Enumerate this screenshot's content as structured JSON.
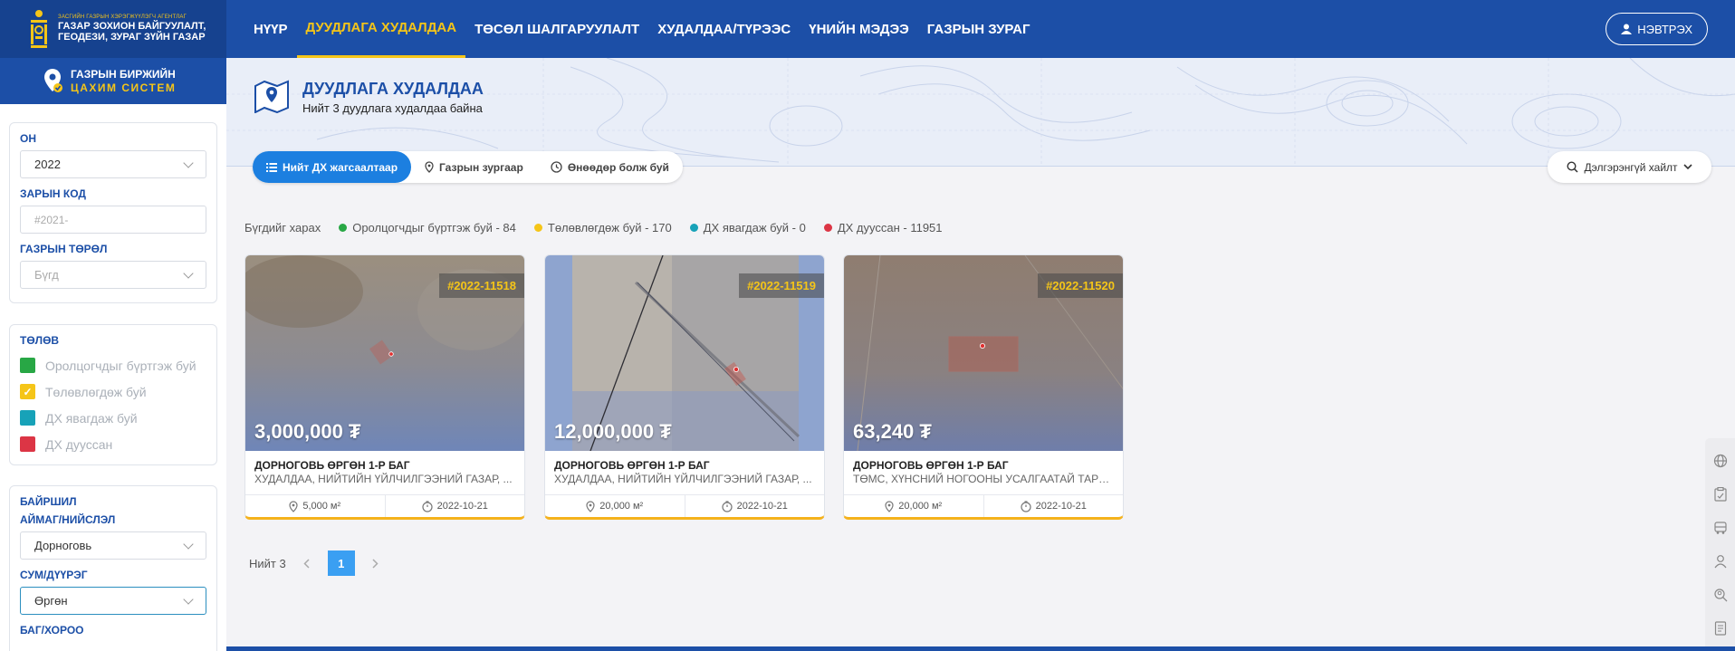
{
  "header": {
    "agency_small": "ЗАСГИЙН ГАЗРЫН ХЭРЭГЖҮҮЛЭГЧ АГЕНТЛАГ",
    "agency_line1": "ГАЗАР ЗОХИОН БАЙГУУЛАЛТ,",
    "agency_line2": "ГЕОДЕЗИ, ЗУРАГ ЗҮЙН ГАЗАР",
    "nav": [
      {
        "label": "НҮҮР"
      },
      {
        "label": "ДУУДЛАГА ХУДАЛДАА",
        "active": true
      },
      {
        "label": "ТӨСӨЛ ШАЛГАРУУЛАЛТ"
      },
      {
        "label": "ХУДАЛДАА/ТҮРЭЭС"
      },
      {
        "label": "ҮНИЙН МЭДЭЭ"
      },
      {
        "label": "ГАЗРЫН ЗУРАГ"
      }
    ],
    "login_label": "НЭВТРЭХ",
    "accent_color": "#f5c518",
    "brand_color": "#1c4fa7"
  },
  "sub_brand": {
    "line1": "ГАЗРЫН БИРЖИЙН",
    "line2": "ЦАХИМ СИСТЕМ"
  },
  "filters": {
    "year_label": "ОН",
    "year_value": "2022",
    "code_label": "ЗАРЫН КОД",
    "code_placeholder": "#2021-",
    "type_label": "ГАЗРЫН ТӨРӨЛ",
    "type_value": "Бүгд",
    "status_label": "ТӨЛӨВ",
    "statuses": [
      {
        "label": "Оролцогчдыг бүртгэж буй",
        "color": "#28a745",
        "checked": false
      },
      {
        "label": "Төлөвлөгдөж буй",
        "color": "#f5c518",
        "checked": true
      },
      {
        "label": "ДХ явагдаж буй",
        "color": "#17a2b8",
        "checked": false
      },
      {
        "label": "ДХ дууссан",
        "color": "#dc3545",
        "checked": false
      }
    ],
    "location_label": "БАЙРШИЛ",
    "aimag_label": "АЙМАГ/НИЙСЛЭЛ",
    "aimag_value": "Дорноговь",
    "sum_label": "СУМ/ДҮҮРЭГ",
    "sum_value": "Өргөн",
    "bag_label": "БАГ/ХОРОО"
  },
  "banner": {
    "title": "ДУУДЛАГА ХУДАЛДАА",
    "subtitle": "Нийт 3 дуудлага худалдаа байна"
  },
  "tabs": [
    {
      "label": "Нийт ДХ жагсаалтаар",
      "icon": "list-icon",
      "active": true
    },
    {
      "label": "Газрын зургаар",
      "icon": "map-pin-icon"
    },
    {
      "label": "Өнөөдөр болж буй",
      "icon": "clock-icon"
    }
  ],
  "advanced_search_label": "Дэлгэрэнгүй хайлт",
  "legend": {
    "all_label": "Бүгдийг харах",
    "items": [
      {
        "label": "Оролцогчдыг бүртгэж буй - 84",
        "color": "#28a745"
      },
      {
        "label": "Төлөвлөгдөж буй - 170",
        "color": "#f5c518"
      },
      {
        "label": "ДХ явагдаж буй - 0",
        "color": "#17a2b8"
      },
      {
        "label": "ДХ дууссан - 11951",
        "color": "#dc3545"
      }
    ]
  },
  "cards": [
    {
      "id": "#2022-11518",
      "price": "3,000,000 ₮",
      "location": "ДОРНОГОВЬ ӨРГӨН 1-Р БАГ",
      "description": "ХУДАЛДАА, НИЙТИЙН ҮЙЛЧИЛГЭЭНИЙ ГАЗАР, ...",
      "area": "5,000 м²",
      "date": "2022-10-21"
    },
    {
      "id": "#2022-11519",
      "price": "12,000,000 ₮",
      "location": "ДОРНОГОВЬ ӨРГӨН 1-Р БАГ",
      "description": "ХУДАЛДАА, НИЙТИЙН ҮЙЛЧИЛГЭЭНИЙ ГАЗАР, ...",
      "area": "20,000 м²",
      "date": "2022-10-21"
    },
    {
      "id": "#2022-11520",
      "price": "63,240 ₮",
      "location": "ДОРНОГОВЬ ӨРГӨН 1-Р БАГ",
      "description": "ТӨМС, ХҮНСНИЙ НОГООНЫ УСАЛГААТАЙ ТАРИА...",
      "area": "20,000 м²",
      "date": "2022-10-21"
    }
  ],
  "pagination": {
    "total_label": "Нийт 3",
    "current_page": "1"
  },
  "side_tools": [
    "globe-icon",
    "clipboard-icon",
    "bus-icon",
    "user-icon",
    "user-search-icon",
    "document-icon"
  ]
}
